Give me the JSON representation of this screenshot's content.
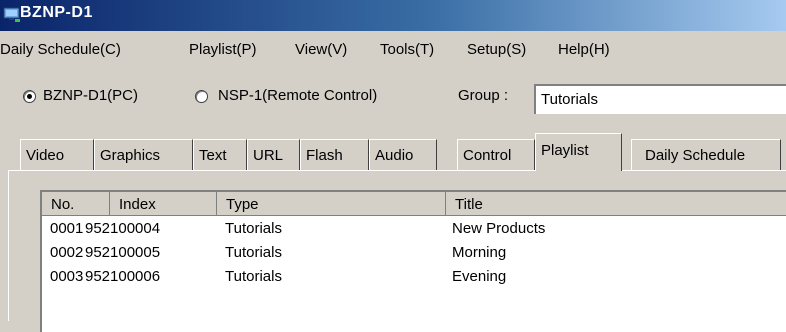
{
  "window": {
    "title": "BZNP-D1"
  },
  "menu": [
    {
      "label": "Daily Schedule(C)"
    },
    {
      "label": "Playlist(P)"
    },
    {
      "label": "View(V)"
    },
    {
      "label": "Tools(T)"
    },
    {
      "label": "Setup(S)"
    },
    {
      "label": "Help(H)"
    }
  ],
  "mode": {
    "options": [
      {
        "label": "BZNP-D1(PC)",
        "selected": true
      },
      {
        "label": "NSP-1(Remote Control)",
        "selected": false
      }
    ],
    "group_label": "Group :",
    "group_value": "Tutorials"
  },
  "tabs": [
    {
      "label": "Video"
    },
    {
      "label": "Graphics"
    },
    {
      "label": "Text"
    },
    {
      "label": "URL"
    },
    {
      "label": "Flash"
    },
    {
      "label": "Audio"
    },
    {
      "label": "Control"
    },
    {
      "label": "Playlist",
      "active": true
    },
    {
      "label": "Daily Schedule"
    }
  ],
  "table": {
    "columns": [
      "No.",
      "Index",
      "Type",
      "Title"
    ],
    "rows": [
      [
        "0001",
        "952100004",
        "Tutorials",
        "New Products"
      ],
      [
        "0002",
        "952100005",
        "Tutorials",
        "Morning"
      ],
      [
        "0003",
        "952100006",
        "Tutorials",
        "Evening"
      ]
    ]
  }
}
